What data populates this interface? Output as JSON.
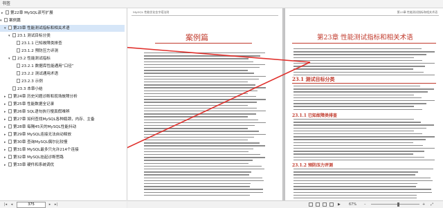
{
  "window": {
    "title": "书签"
  },
  "sidebar": {
    "items": [
      {
        "label": "第22章 MySQL读写扩展",
        "level": 1,
        "expanded": false
      },
      {
        "label": "案例篇",
        "level": 0,
        "expanded": true
      },
      {
        "label": "第23章 性能测试指标和相关术语",
        "level": 1,
        "expanded": true
      },
      {
        "label": "23.1 测试目标分类",
        "level": 2,
        "expanded": true
      },
      {
        "label": "23.1.1 已知故障类排查",
        "level": 3
      },
      {
        "label": "23.1.2 预防压力评测",
        "level": 3
      },
      {
        "label": "23.2 性能测试指标",
        "level": 2,
        "expanded": true
      },
      {
        "label": "23.2.1 数据库性能通用“口径”",
        "level": 3
      },
      {
        "label": "23.2.2 测试通用术语",
        "level": 3
      },
      {
        "label": "23.2.3 示例",
        "level": 3
      },
      {
        "label": "23.3 本章小结",
        "level": 2
      },
      {
        "label": "第24章 历史问题诊断和现场故障分析",
        "level": 1,
        "expanded": false
      },
      {
        "label": "第25章 性能数据全记录",
        "level": 1,
        "expanded": false
      },
      {
        "label": "第26章 SQL语句执行慢真假难辨",
        "level": 1,
        "expanded": false
      },
      {
        "label": "第27章 如何查找MySQL各种瓶颈，内存、主备",
        "level": 1,
        "expanded": false
      },
      {
        "label": "第28章 每隔45天的MySQL性能抖动",
        "level": 1,
        "expanded": false
      },
      {
        "label": "第29章 MySQL连接无法自动释放",
        "level": 1,
        "expanded": false
      },
      {
        "label": "第30章 查询MySQL偶尔比较慢",
        "level": 1,
        "expanded": false
      },
      {
        "label": "第31章 MySQL最多只允许214个连接",
        "level": 1,
        "expanded": false
      },
      {
        "label": "第32章 MySQL挂起诊断思路",
        "level": 1,
        "expanded": false
      },
      {
        "label": "第33章 硬件和系统调优",
        "level": 1,
        "expanded": false
      }
    ],
    "page_number": "375"
  },
  "document": {
    "left_page": {
      "header": "MySQL 性能优化金字塔法则",
      "heading": "案例篇"
    },
    "right_page": {
      "header": "第23章 性能测试指标和相关术语",
      "chapter_title": "第23章 性能测试指标和相关术语",
      "section1": "23.1 测试目标分类",
      "section11": "23.1.1 已知故障类排查",
      "section12": "23.1.2 预防压力评测"
    }
  },
  "status": {
    "zoom": "67%"
  },
  "colors": {
    "accent": "#c0392b",
    "arrow": "#e0302c",
    "selected": "#d6e6f8"
  }
}
